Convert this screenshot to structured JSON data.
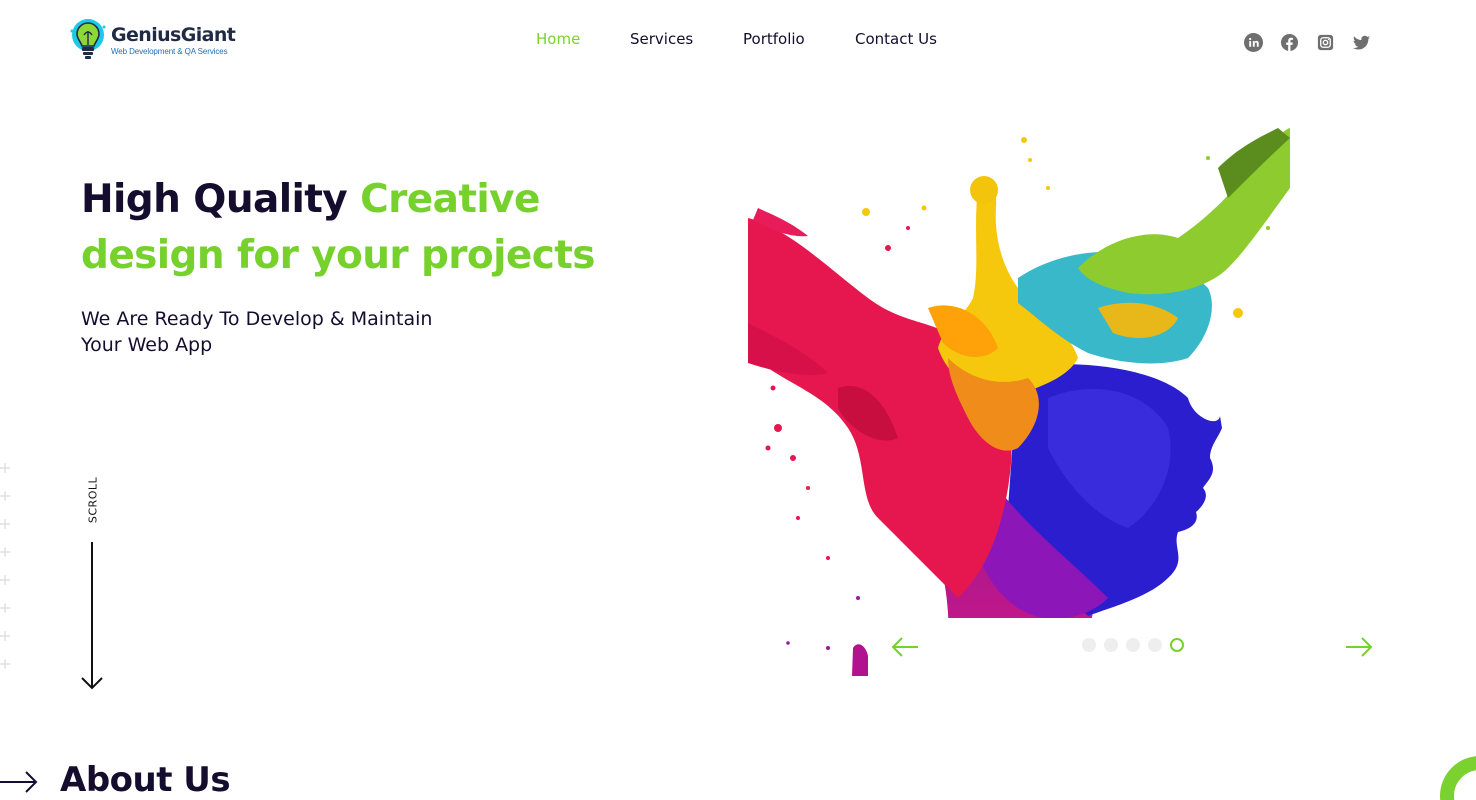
{
  "header": {
    "logo": {
      "name": "GeniusGiant",
      "tagline": "Web Development & QA Services"
    },
    "nav": [
      {
        "label": "Home",
        "active": true
      },
      {
        "label": "Services",
        "active": false
      },
      {
        "label": "Portfolio",
        "active": false
      },
      {
        "label": "Contact Us",
        "active": false
      }
    ],
    "social_icons": [
      "linkedin-icon",
      "facebook-icon",
      "instagram-icon",
      "twitter-icon"
    ]
  },
  "hero": {
    "title_dark": "High Quality ",
    "title_green_1": "Creative",
    "title_green_2": "design for your projects",
    "subtitle_line1": "We Are Ready To Develop & Maintain",
    "subtitle_line2": "Your Web App",
    "scroll_label": "SCROLL"
  },
  "slider": {
    "image": "colorful-paint-splash-head-profile",
    "slide_count": 5,
    "active_slide": 5
  },
  "about": {
    "title": "About Us"
  },
  "colors": {
    "accent": "#77d12c",
    "text_dark": "#140d2e",
    "social_gray": "#6f6f6f"
  }
}
